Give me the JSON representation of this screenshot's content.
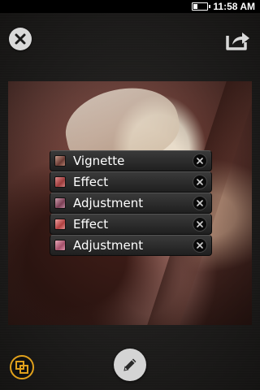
{
  "status_bar": {
    "time": "11:58 AM",
    "battery_level_fraction": 0.3,
    "battery_icon": "battery-icon"
  },
  "toolbar": {
    "close_icon": "close-icon",
    "share_icon": "share-icon"
  },
  "adjustments": [
    {
      "label": "Vignette",
      "remove_icon": "remove-icon"
    },
    {
      "label": "Effect",
      "remove_icon": "remove-icon"
    },
    {
      "label": "Adjustment",
      "remove_icon": "remove-icon"
    },
    {
      "label": "Effect",
      "remove_icon": "remove-icon"
    },
    {
      "label": "Adjustment",
      "remove_icon": "remove-icon"
    }
  ],
  "bottom_bar": {
    "layers_icon": "layers-icon",
    "edit_icon": "pencil-icon",
    "accent_color": "#e0a01c"
  }
}
